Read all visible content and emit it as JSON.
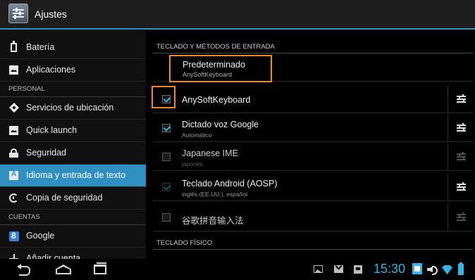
{
  "app": {
    "title": "Ajustes"
  },
  "sidebar": {
    "items": [
      {
        "label": "Batería",
        "icon": "battery-icon"
      },
      {
        "label": "Aplicaciones",
        "icon": "apps-icon"
      },
      {
        "header": "PERSONAL"
      },
      {
        "label": "Servicios de ubicación",
        "icon": "location-icon"
      },
      {
        "label": "Quick launch",
        "icon": "quick-launch-icon"
      },
      {
        "label": "Seguridad",
        "icon": "lock-icon"
      },
      {
        "label": "Idioma y entrada de texto",
        "icon": "language-icon",
        "selected": true
      },
      {
        "label": "Copia de seguridad",
        "icon": "backup-icon"
      },
      {
        "header": "CUENTAS"
      },
      {
        "label": "Google",
        "icon": "google-icon"
      },
      {
        "label": "Añadir cuenta",
        "icon": "plus-icon"
      }
    ]
  },
  "main": {
    "section_keyboard": "TECLADO Y MÉTODOS DE ENTRADA",
    "default": {
      "title": "Predeterminado",
      "value": "AnySoftKeyboard"
    },
    "methods": [
      {
        "name": "AnySoftKeyboard",
        "summary": "",
        "checked": true,
        "enabled": true
      },
      {
        "name": "Dictado voz Google",
        "summary": "Automático",
        "checked": true,
        "enabled": true
      },
      {
        "name": "Japanese IME",
        "summary": "japonés",
        "checked": false,
        "enabled": false
      },
      {
        "name": "Teclado Android (AOSP)",
        "summary": "inglés (EE.UU.), español",
        "checked": true,
        "enabled": false
      },
      {
        "name": "谷歌拼音输入法",
        "summary": "",
        "checked": false,
        "enabled": false
      }
    ],
    "section_physical": "TECLADO FÍSICO"
  },
  "statusbar": {
    "clock": "15:30"
  },
  "colors": {
    "accent": "#33b5e5",
    "selected": "#2f8fc1",
    "highlight": "#f28a1c"
  }
}
